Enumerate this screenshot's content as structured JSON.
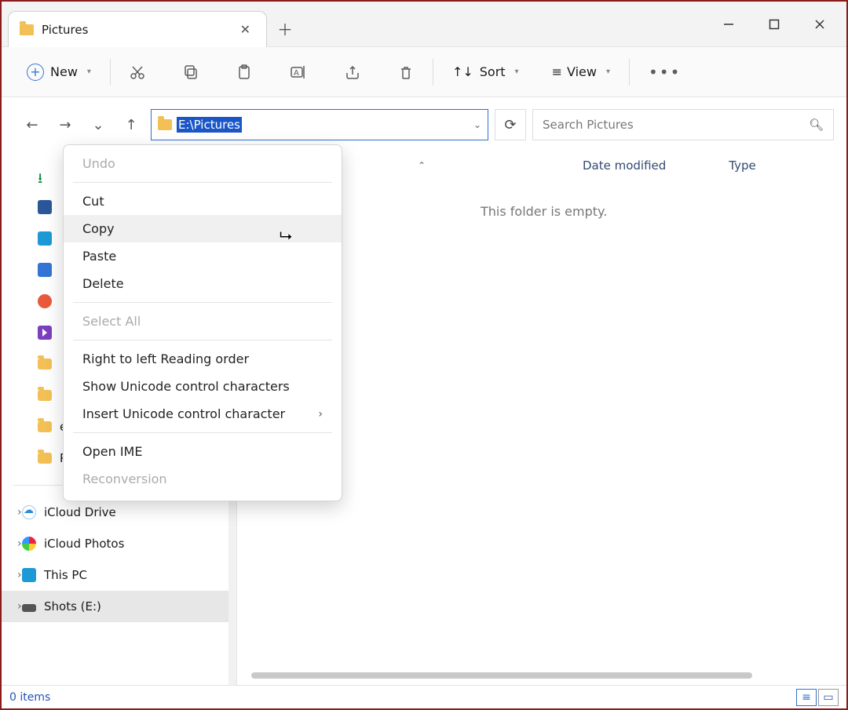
{
  "tab": {
    "title": "Pictures"
  },
  "toolbar": {
    "new_label": "New",
    "sort_label": "Sort",
    "view_label": "View"
  },
  "address": {
    "path": "E:\\Pictures",
    "search_placeholder": "Search Pictures"
  },
  "columns": {
    "date_modified": "Date modified",
    "type": "Type"
  },
  "content": {
    "empty_message": "This folder is empty."
  },
  "context_menu": {
    "undo": "Undo",
    "cut": "Cut",
    "copy": "Copy",
    "paste": "Paste",
    "delete": "Delete",
    "select_all": "Select All",
    "rtl": "Right to left Reading order",
    "show_unicode": "Show Unicode control characters",
    "insert_unicode": "Insert Unicode control character",
    "open_ime": "Open IME",
    "reconversion": "Reconversion"
  },
  "sidebar": {
    "ers": "ers",
    "ping": "PING",
    "icloud_drive": "iCloud Drive",
    "icloud_photos": "iCloud Photos",
    "this_pc": "This PC",
    "shots_e": "Shots (E:)"
  },
  "status": {
    "items": "0 items"
  }
}
